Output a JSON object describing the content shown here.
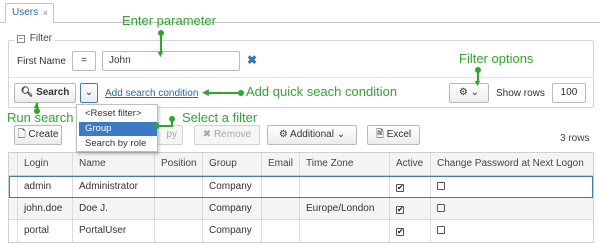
{
  "tab": {
    "title": "Users",
    "close_glyph": "×"
  },
  "filter": {
    "legend": "Filter",
    "collapse_glyph": "−",
    "field_label": "First Name",
    "operator": "=",
    "value": "John",
    "clear_glyph": "✖",
    "search_label": "Search",
    "add_condition_label": "Add search condition",
    "show_rows_label": "Show rows",
    "rows_value": "100",
    "dropdown_items": [
      "<Reset filter>",
      "Group",
      "Search by role"
    ],
    "selected_item": "Group"
  },
  "toolbar": {
    "create_label": "Create",
    "copy_label": "py",
    "remove_label": "Remove",
    "additional_label": "Additional",
    "excel_label": "Excel",
    "rows_count": "3 rows"
  },
  "table": {
    "headers": [
      "Login",
      "Name",
      "Position",
      "Group",
      "Email",
      "Time Zone",
      "Active",
      "Change Password at Next Logon"
    ],
    "rows": [
      {
        "login": "admin",
        "name": "Administrator",
        "position": "",
        "group": "Company",
        "email": "",
        "timezone": "",
        "active": true,
        "change_password": false
      },
      {
        "login": "john.doe",
        "name": "Doe J.",
        "position": "",
        "group": "Company",
        "email": "",
        "timezone": "Europe/London",
        "active": true,
        "change_password": false
      },
      {
        "login": "portal",
        "name": "PortalUser",
        "position": "",
        "group": "Company",
        "email": "",
        "timezone": "",
        "active": true,
        "change_password": false
      }
    ]
  },
  "annotations": {
    "enter_parameter": "Enter parameter",
    "filter_options": "Filter options",
    "add_quick_condition": "Add quick seach condition",
    "run_search": "Run search",
    "select_filter": "Select a filter"
  },
  "colors": {
    "annotation": "#2aaa29",
    "link": "#1f6bb3",
    "selection": "#3b7bc6"
  },
  "icons": [
    "close-icon",
    "collapse-icon",
    "clear-icon",
    "search-icon",
    "chevron-down-icon",
    "gear-icon",
    "create-icon",
    "copy-icon",
    "remove-icon",
    "settings-icon",
    "excel-icon",
    "checkbox-icon"
  ]
}
